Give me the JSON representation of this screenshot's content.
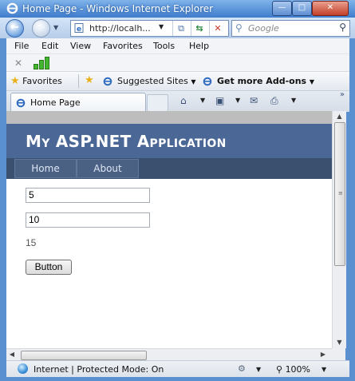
{
  "window": {
    "title": "Home Page - Windows Internet Explorer",
    "minimize": "—",
    "maximize": "□",
    "close": "✕"
  },
  "address": {
    "url": "http://localh...",
    "search_placeholder": "Google"
  },
  "menu": {
    "items": [
      "File",
      "Edit",
      "View",
      "Favorites",
      "Tools",
      "Help"
    ]
  },
  "favorites_bar": {
    "favorites": "Favorites",
    "suggested_sites": "Suggested Sites",
    "get_addons": "Get more Add-ons"
  },
  "tab": {
    "label": "Home Page"
  },
  "site": {
    "title": "My ASP.NET Application",
    "nav": [
      "Home",
      "About"
    ]
  },
  "form": {
    "textbox1": "5",
    "textbox2": "10",
    "result": "15",
    "button_label": "Button"
  },
  "status": {
    "text": "Internet | Protected Mode: On",
    "zoom": "100%"
  },
  "colors": {
    "site_header": "#4a6796",
    "site_nav": "#3b4f6e",
    "accent_green": "#44b52e"
  }
}
